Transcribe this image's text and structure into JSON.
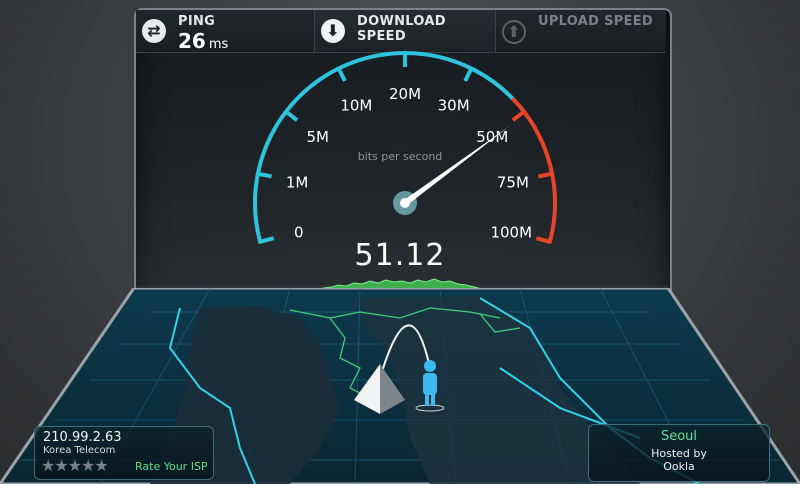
{
  "tabs": {
    "ping": {
      "label": "PING",
      "value": "26",
      "unit": "ms",
      "icon": "swap-arrows-icon"
    },
    "download": {
      "label": "DOWNLOAD SPEED",
      "icon": "download-arrow-icon"
    },
    "upload": {
      "label": "UPLOAD SPEED",
      "icon": "upload-arrow-icon"
    }
  },
  "gauge": {
    "unit_label": "bits per second",
    "readout": "51.12",
    "needle_value": 51.12,
    "ticks": [
      {
        "label": "0",
        "value": 0
      },
      {
        "label": "1M",
        "value": 1
      },
      {
        "label": "5M",
        "value": 5
      },
      {
        "label": "10M",
        "value": 10
      },
      {
        "label": "20M",
        "value": 20
      },
      {
        "label": "30M",
        "value": 30
      },
      {
        "label": "50M",
        "value": 50
      },
      {
        "label": "75M",
        "value": 75
      },
      {
        "label": "100M",
        "value": 100
      }
    ],
    "colors": {
      "arc": "#2fc4de",
      "danger": "#e8442a",
      "needle": "#ffffff",
      "graph": "#5cd46a"
    }
  },
  "client": {
    "ip": "210.99.2.63",
    "isp": "Korea Telecom",
    "stars": "★★★★★",
    "rate_label": "Rate Your ISP"
  },
  "server": {
    "city": "Seoul",
    "hosted_by_label": "Hosted by",
    "host": "Ookla"
  }
}
